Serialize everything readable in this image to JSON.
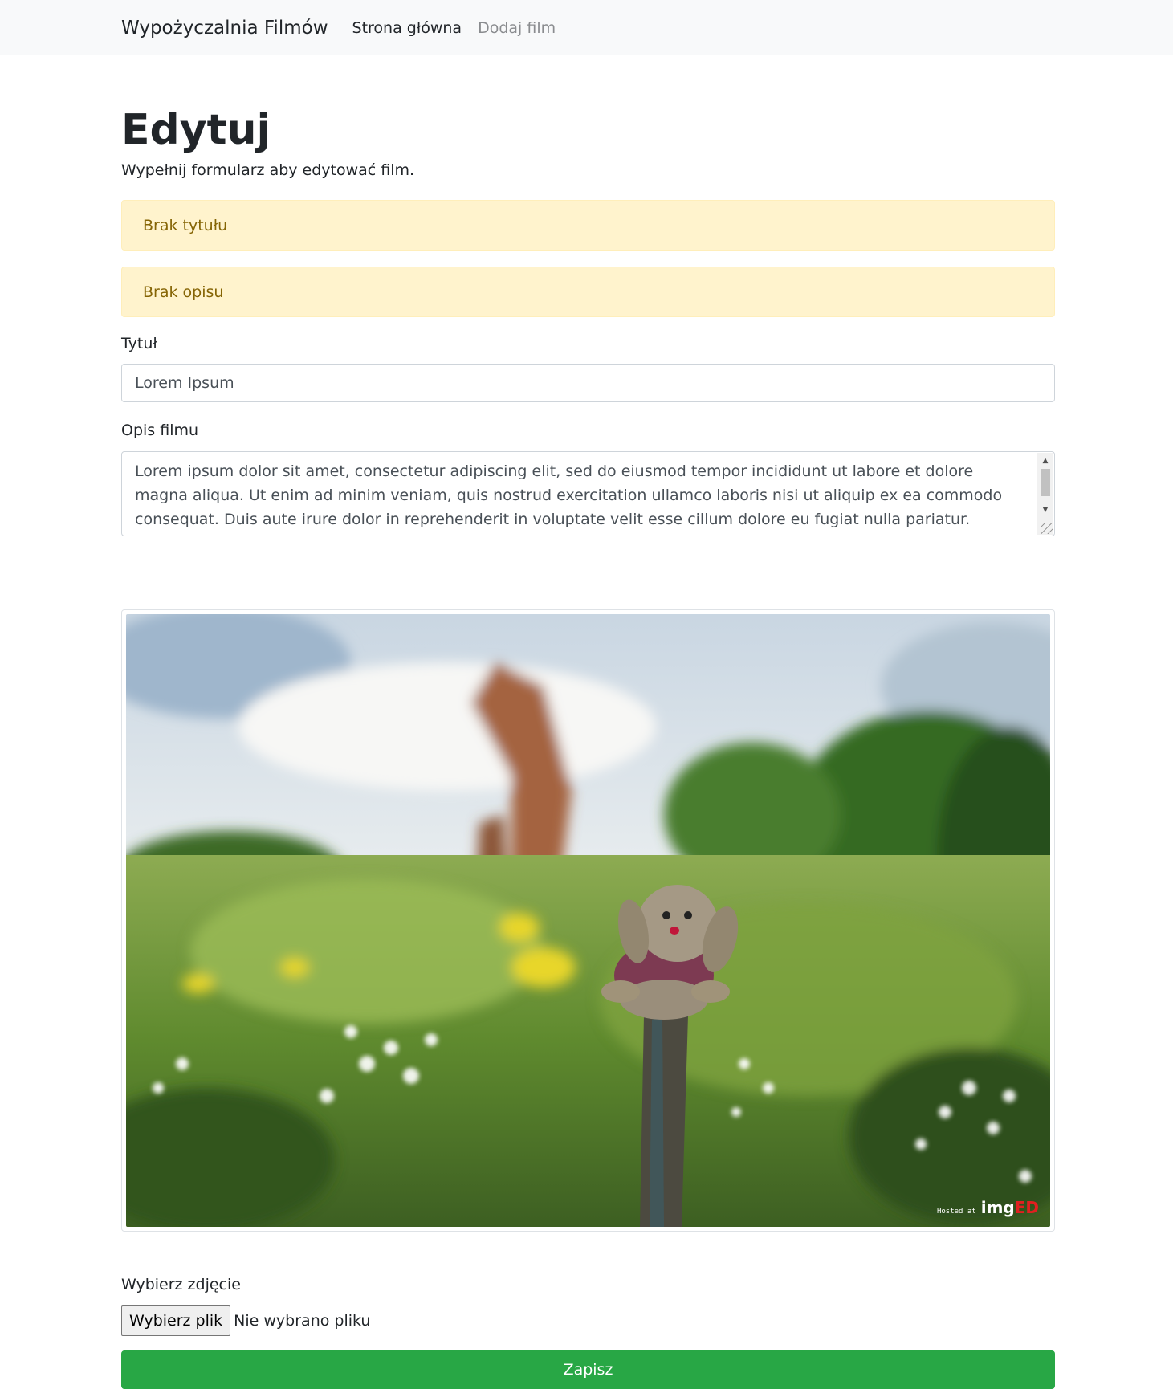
{
  "navbar": {
    "brand": "Wypożyczalnia Filmów",
    "links": [
      {
        "label": "Strona główna",
        "state": "active"
      },
      {
        "label": "Dodaj film",
        "state": "muted"
      }
    ]
  },
  "page": {
    "title": "Edytuj",
    "subtitle": "Wypełnij formularz aby edytować film."
  },
  "alerts": [
    "Brak tytułu",
    "Brak opisu"
  ],
  "form": {
    "title_label": "Tytuł",
    "title_value": "Lorem Ipsum",
    "description_label": "Opis filmu",
    "description_value": "Lorem ipsum dolor sit amet, consectetur adipiscing elit, sed do eiusmod tempor incididunt ut labore et dolore magna aliqua. Ut enim ad minim veniam, quis nostrud exercitation ullamco laboris nisi ut aliquip ex ea commodo consequat. Duis aute irure dolor in reprehenderit in voluptate velit esse cillum dolore eu fugiat nulla pariatur. Excepteur sint occaecat cupidatat non",
    "image": {
      "watermark_small": "Hosted at",
      "watermark_brand_a": "img",
      "watermark_brand_b": "ED"
    },
    "file_label": "Wybierz zdjęcie",
    "file_button": "Wybierz plik",
    "file_status": "Nie wybrano pliku",
    "submit_label": "Zapisz"
  },
  "colors": {
    "navbar_bg": "#f8f9fa",
    "alert_bg": "#fff3cd",
    "alert_text": "#856404",
    "submit_bg": "#28a745"
  }
}
